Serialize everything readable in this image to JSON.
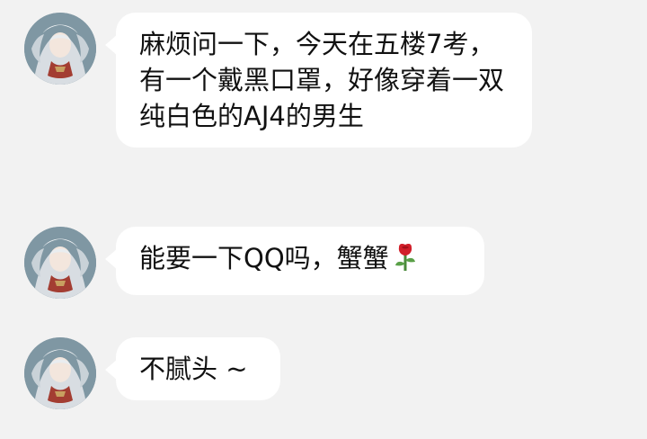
{
  "messages": [
    {
      "text": "麻烦问一下，今天在五楼7考，有一个戴黑口罩，好像穿着一双纯白色的AJ4的男生",
      "emoji": ""
    },
    {
      "text": "能要一下QQ吗，蟹蟹",
      "emoji": "rose"
    },
    {
      "text": "不腻头 ~",
      "emoji": ""
    }
  ],
  "colors": {
    "background": "#f2f2f2",
    "bubble": "#ffffff",
    "text": "#111111"
  },
  "icons": {
    "avatar": "anime-avatar",
    "emoji_rose": "rose-emoji-icon"
  }
}
